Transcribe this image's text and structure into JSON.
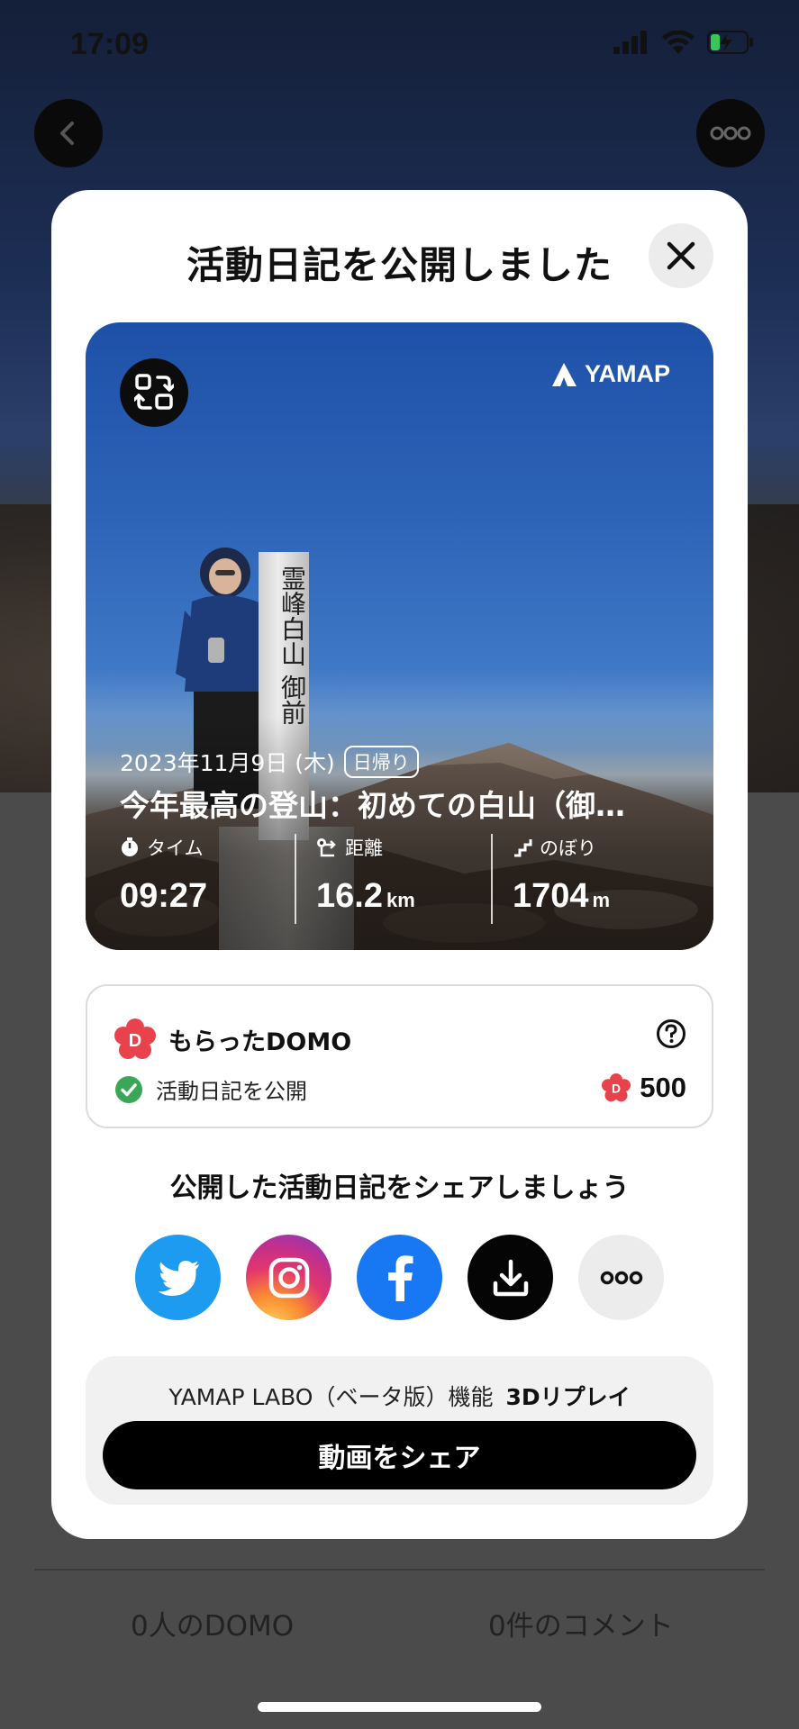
{
  "status_bar": {
    "time": "17:09"
  },
  "background": {
    "stats": {
      "domo": "0人のDOMO",
      "comments": "0件のコメント"
    }
  },
  "modal": {
    "title": "活動日記を公開しました",
    "photo_card": {
      "brand": "YAMAP",
      "pillar_text": "霊峰白山 御前",
      "date": "2023年11月9日 (木)",
      "tag": "日帰り",
      "title": "今年最高の登山：初めての白山（御…",
      "stats": [
        {
          "label": "タイム",
          "value": "09:27",
          "unit": ""
        },
        {
          "label": "距離",
          "value": "16.2",
          "unit": "km"
        },
        {
          "label": "のぼり",
          "value": "1704",
          "unit": "m"
        }
      ]
    },
    "domo_card": {
      "heading": "もらったDOMO",
      "item": "活動日記を公開",
      "points": "500"
    },
    "share": {
      "title": "公開した活動日記をシェアしましょう",
      "buttons": [
        "twitter-icon",
        "instagram-icon",
        "facebook-icon",
        "download-icon",
        "more-icon"
      ]
    },
    "labo": {
      "label": "YAMAP LABO（ベータ版）機能",
      "feature": "3Dリプレイ",
      "button": "動画をシェア"
    }
  },
  "colors": {
    "twitter": "#1d9bf0",
    "facebook": "#1877f2",
    "domo_red": "#e8424c",
    "check_green": "#3aa757"
  }
}
